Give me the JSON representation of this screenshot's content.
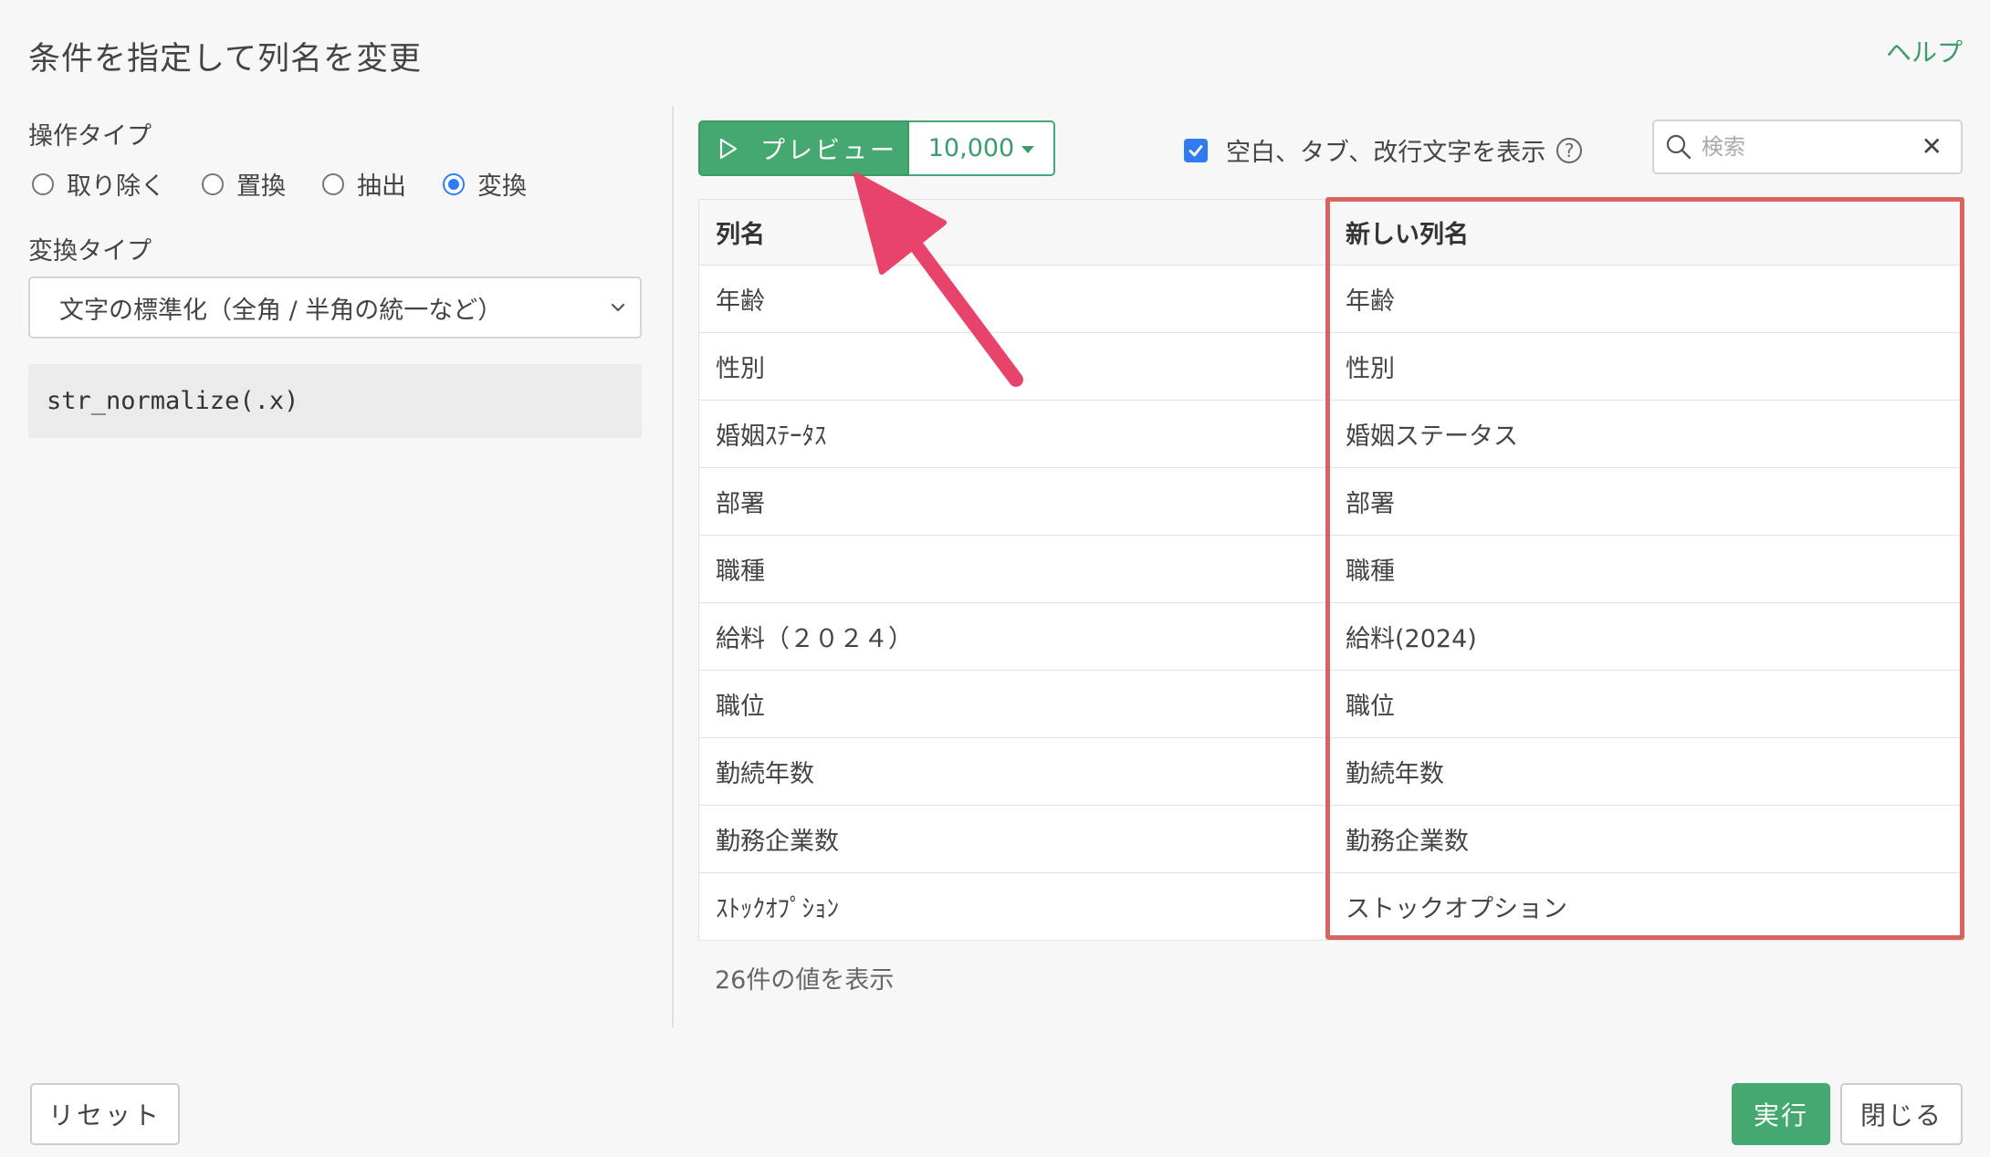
{
  "header": {
    "title": "条件を指定して列名を変更",
    "help_label": "ヘルプ"
  },
  "operation": {
    "label": "操作タイプ",
    "options": [
      {
        "label": "取り除く",
        "checked": false
      },
      {
        "label": "置換",
        "checked": false
      },
      {
        "label": "抽出",
        "checked": false
      },
      {
        "label": "変換",
        "checked": true
      }
    ]
  },
  "conversion": {
    "label": "変換タイプ",
    "selected": "文字の標準化（全角 / 半角の統一など）",
    "code": "str_normalize(.x)"
  },
  "preview": {
    "button_label": "プレビュー",
    "count": "10,000",
    "show_whitespace_label": "空白、タブ、改行文字を表示",
    "show_whitespace_checked": true,
    "help_symbol": "?"
  },
  "search": {
    "placeholder": "検索",
    "clear_symbol": "✕"
  },
  "table": {
    "headers": [
      "列名",
      "新しい列名"
    ],
    "rows": [
      [
        "年齢",
        "年齢"
      ],
      [
        "性別",
        "性別"
      ],
      [
        "婚姻ｽﾃｰﾀｽ",
        "婚姻ステータス"
      ],
      [
        "部署",
        "部署"
      ],
      [
        "職種",
        "職種"
      ],
      [
        "給料（２０２４）",
        "給料(2024)"
      ],
      [
        "職位",
        "職位"
      ],
      [
        "勤続年数",
        "勤続年数"
      ],
      [
        "勤務企業数",
        "勤務企業数"
      ],
      [
        "ｽﾄｯｸｵﾌﾟｼｮﾝ",
        "ストックオプション"
      ]
    ],
    "summary": "26件の値を表示"
  },
  "footer": {
    "reset_label": "リセット",
    "run_label": "実行",
    "close_label": "閉じる"
  },
  "colors": {
    "accent_green": "#45a870",
    "highlight_red": "#d9645f",
    "arrow_pink": "#e8436b",
    "checkbox_blue": "#2f7cf0"
  }
}
